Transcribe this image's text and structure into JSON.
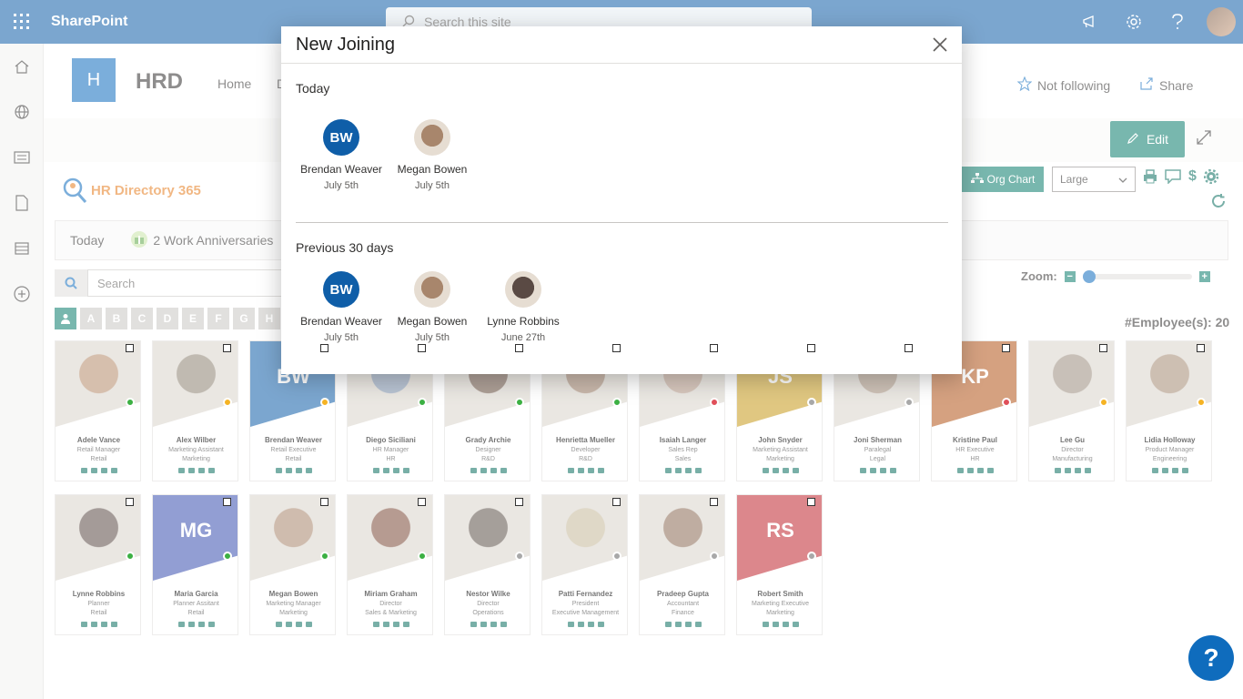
{
  "topbar": {
    "brand": "SharePoint",
    "search_placeholder": "Search this site"
  },
  "site": {
    "logo_letter": "H",
    "title": "HRD",
    "nav": [
      "Home",
      "D"
    ],
    "follow_label": "Not following",
    "share_label": "Share"
  },
  "command": {
    "edit_label": "Edit"
  },
  "webpart": {
    "logo_text": "HR Directory 365",
    "org_chart_label": "Org Chart",
    "size_value": "Large",
    "today_label": "Today",
    "anniversaries_label": "2 Work Anniversaries",
    "search_placeholder": "Search",
    "zoom_label": "Zoom:",
    "zoom_minus": "−",
    "zoom_plus": "+",
    "zoom_level": 0.0,
    "alphabet": [
      "A",
      "B",
      "C",
      "D",
      "E",
      "F",
      "G",
      "H"
    ],
    "employee_count": "#Employee(s): 20"
  },
  "employees": [
    {
      "name": "Adele Vance",
      "title": "Retail Manager",
      "dept": "Retail",
      "presence": "#3cb043",
      "photo": "#b58a6a",
      "initials": ""
    },
    {
      "name": "Alex Wilber",
      "title": "Marketing Assistant",
      "dept": "Marketing",
      "presence": "#f5b324",
      "photo": "#8d8272",
      "initials": ""
    },
    {
      "name": "Brendan Weaver",
      "title": "Retail Executive",
      "dept": "Retail",
      "presence": "#f5b324",
      "photo": "#0f5ea8",
      "initials": "BW"
    },
    {
      "name": "Diego Siciliani",
      "title": "HR Manager",
      "dept": "HR",
      "presence": "#3cb043",
      "photo": "#7f93ad",
      "initials": ""
    },
    {
      "name": "Grady Archie",
      "title": "Designer",
      "dept": "R&D",
      "presence": "#3cb043",
      "photo": "#6b5040",
      "initials": ""
    },
    {
      "name": "Henrietta Mueller",
      "title": "Developer",
      "dept": "R&D",
      "presence": "#3cb043",
      "photo": "#9c7d65",
      "initials": ""
    },
    {
      "name": "Isaiah Langer",
      "title": "Sales Rep",
      "dept": "Sales",
      "presence": "#e0505a",
      "photo": "#b49886",
      "initials": ""
    },
    {
      "name": "John Snyder",
      "title": "Marketing Assistant",
      "dept": "Marketing",
      "presence": "#a8a8a8",
      "photo": "#c79a1a",
      "initials": "JS"
    },
    {
      "name": "Joni Sherman",
      "title": "Paralegal",
      "dept": "Legal",
      "presence": "#a8a8a8",
      "photo": "#a58e7a",
      "initials": ""
    },
    {
      "name": "Kristine Paul",
      "title": "HR Executive",
      "dept": "HR",
      "presence": "#e0505a",
      "photo": "#b35418",
      "initials": "KP"
    },
    {
      "name": "Lee Gu",
      "title": "Director",
      "dept": "Manufacturing",
      "presence": "#f5b324",
      "photo": "#9b8d7e",
      "initials": ""
    },
    {
      "name": "Lidia Holloway",
      "title": "Product Manager",
      "dept": "Engineering",
      "presence": "#f5b324",
      "photo": "#a58a73",
      "initials": ""
    },
    {
      "name": "Lynne Robbins",
      "title": "Planner",
      "dept": "Retail",
      "presence": "#3cb043",
      "photo": "#5a4a44",
      "initials": ""
    },
    {
      "name": "Maria Garcia",
      "title": "Planner Assitant",
      "dept": "Retail",
      "presence": "#3cb043",
      "photo": "#3a4fb0",
      "initials": "MG"
    },
    {
      "name": "Megan Bowen",
      "title": "Marketing Manager",
      "dept": "Marketing",
      "presence": "#3cb043",
      "photo": "#a8866c",
      "initials": ""
    },
    {
      "name": "Miriam Graham",
      "title": "Director",
      "dept": "Sales & Marketing",
      "presence": "#3cb043",
      "photo": "#7a4a38",
      "initials": ""
    },
    {
      "name": "Nestor Wilke",
      "title": "Director",
      "dept": "Operations",
      "presence": "#a8a8a8",
      "photo": "#5c5048",
      "initials": ""
    },
    {
      "name": "Patti Fernandez",
      "title": "President",
      "dept": "Executive Management",
      "presence": "#a8a8a8",
      "photo": "#c5b89a",
      "initials": ""
    },
    {
      "name": "Pradeep Gupta",
      "title": "Accountant",
      "dept": "Finance",
      "presence": "#a8a8a8",
      "photo": "#8a6a54",
      "initials": ""
    },
    {
      "name": "Robert Smith",
      "title": "Marketing Executive",
      "dept": "Marketing",
      "presence": "#a8a8a8",
      "photo": "#c0262f",
      "initials": "RS"
    }
  ],
  "modal": {
    "title": "New Joining",
    "today_heading": "Today",
    "today_people": [
      {
        "name": "Brendan Weaver",
        "date": "July 5th",
        "initials": "BW",
        "color": "#0f5ea8"
      },
      {
        "name": "Megan Bowen",
        "date": "July 5th",
        "initials": "",
        "color": "#a8866c"
      }
    ],
    "previous_heading": "Previous 30 days",
    "previous_people": [
      {
        "name": "Brendan Weaver",
        "date": "July 5th",
        "initials": "BW",
        "color": "#0f5ea8"
      },
      {
        "name": "Megan Bowen",
        "date": "July 5th",
        "initials": "",
        "color": "#a8866c"
      },
      {
        "name": "Lynne Robbins",
        "date": "June 27th",
        "initials": "",
        "color": "#5a4a44"
      }
    ]
  },
  "help_fab": "?",
  "colors": {
    "suite": "#0f5ea8",
    "accent": "#0a7d6c",
    "brand_blue": "#0f6cbd"
  }
}
